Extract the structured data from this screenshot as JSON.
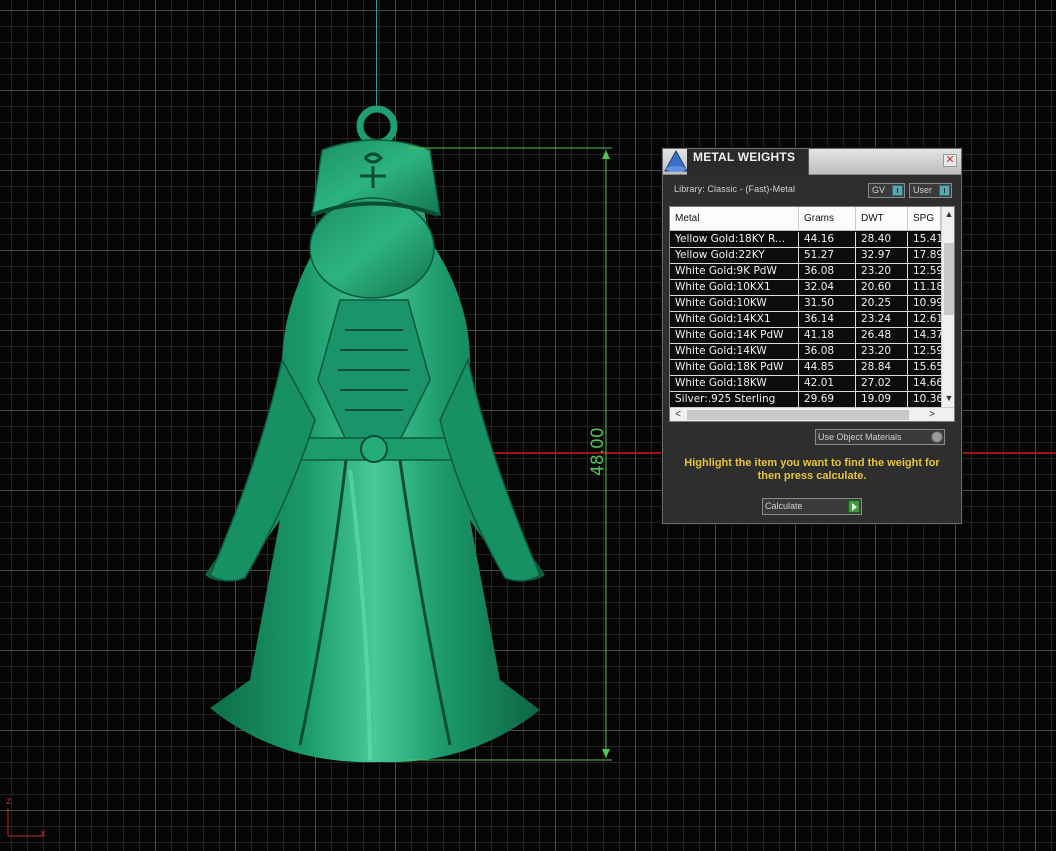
{
  "viewport": {
    "dimension_value": "48.00",
    "axis_triad": {
      "z_label": "z",
      "x_label": "x"
    },
    "colors": {
      "model": "#1f9e6f",
      "dimension": "#52c452",
      "grid": "#4a4a4a",
      "x_axis": "#9e1414",
      "y_axis": "#2a9a9a"
    }
  },
  "panel": {
    "title": "METAL WEIGHTS",
    "library_label": "Library: Classic - (Fast)-Metal",
    "toggles": {
      "gv": "GV",
      "user": "User"
    },
    "columns": [
      "Metal",
      "Grams",
      "DWT",
      "SPG"
    ],
    "rows": [
      [
        "Yellow Gold:18KY R...",
        "44.16",
        "28.40",
        "15.41"
      ],
      [
        "Yellow Gold:22KY",
        "51.27",
        "32.97",
        "17.89"
      ],
      [
        "White Gold:9K PdW",
        "36.08",
        "23.20",
        "12.59"
      ],
      [
        "White Gold:10KX1",
        "32.04",
        "20.60",
        "11.18"
      ],
      [
        "White Gold:10KW",
        "31.50",
        "20.25",
        "10.99"
      ],
      [
        "White Gold:14KX1",
        "36.14",
        "23.24",
        "12.61"
      ],
      [
        "White Gold:14K PdW",
        "41.18",
        "26.48",
        "14.37"
      ],
      [
        "White Gold:14KW",
        "36.08",
        "23.20",
        "12.59"
      ],
      [
        "White Gold:18K PdW",
        "44.85",
        "28.84",
        "15.65"
      ],
      [
        "White Gold:18KW",
        "42.01",
        "27.02",
        "14.66"
      ],
      [
        "Silver:.925 Sterling",
        "29.69",
        "19.09",
        "10.36"
      ]
    ],
    "materials_dropdown": "Use Object Materials",
    "instruction": "Highlight the item you want to find the weight for then press calculate.",
    "calculate_label": "Calculate",
    "icons": {
      "close": "close-icon",
      "scroll_up": "▲",
      "scroll_down": "▼",
      "scroll_left": "<",
      "scroll_right": ">"
    }
  }
}
